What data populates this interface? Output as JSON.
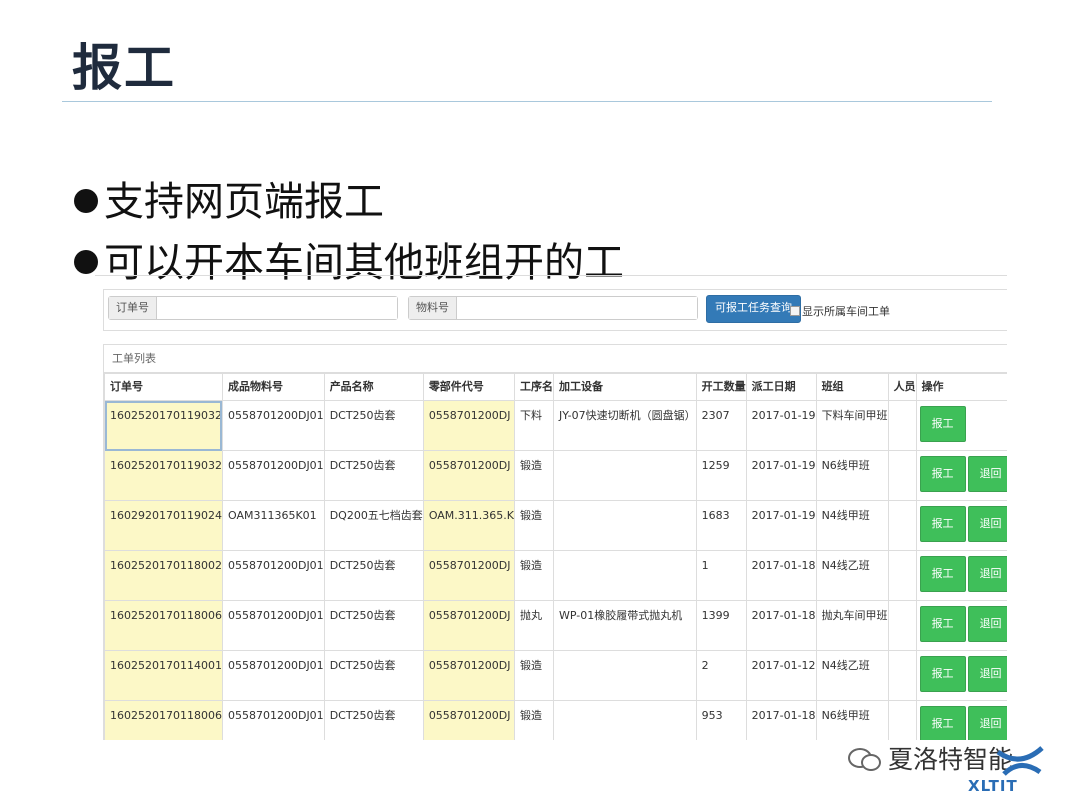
{
  "slide": {
    "title": "报工",
    "bullets": [
      "支持网页端报工",
      "可以开本车间其他班组开的工"
    ]
  },
  "search": {
    "order_label": "订单号",
    "order_value": "",
    "material_label": "物料号",
    "material_value": "",
    "query_button": "可报工任务查询",
    "checkbox_label": "显示所属车间工单",
    "checkbox_checked": false
  },
  "panel": {
    "title": "工单列表",
    "columns": [
      "订单号",
      "成品物料号",
      "产品名称",
      "零部件代号",
      "工序名",
      "加工设备",
      "开工数量",
      "派工日期",
      "班组",
      "人员",
      "操作"
    ],
    "rows": [
      {
        "order": "1602520170119032",
        "product_code": "0558701200DJ01",
        "product_name": "DCT250齿套",
        "part_code": "0558701200DJ",
        "process": "下料",
        "equipment": "JY-07快速切断机（圆盘锯）",
        "qty": "2307",
        "date": "2017-01-19",
        "team": "下料车间甲班",
        "person": "",
        "report": "报工",
        "back": ""
      },
      {
        "order": "1602520170119032",
        "product_code": "0558701200DJ01",
        "product_name": "DCT250齿套",
        "part_code": "0558701200DJ",
        "process": "锻造",
        "equipment": "",
        "qty": "1259",
        "date": "2017-01-19",
        "team": "N6线甲班",
        "person": "",
        "report": "报工",
        "back": "退回"
      },
      {
        "order": "1602920170119024",
        "product_code": "OAM311365K01",
        "product_name": "DQ200五七档齿套",
        "part_code": "OAM.311.365.K",
        "process": "锻造",
        "equipment": "",
        "qty": "1683",
        "date": "2017-01-19",
        "team": "N4线甲班",
        "person": "",
        "report": "报工",
        "back": "退回"
      },
      {
        "order": "1602520170118002",
        "product_code": "0558701200DJ01",
        "product_name": "DCT250齿套",
        "part_code": "0558701200DJ",
        "process": "锻造",
        "equipment": "",
        "qty": "1",
        "date": "2017-01-18",
        "team": "N4线乙班",
        "person": "",
        "report": "报工",
        "back": "退回"
      },
      {
        "order": "1602520170118006",
        "product_code": "0558701200DJ01",
        "product_name": "DCT250齿套",
        "part_code": "0558701200DJ",
        "process": "抛丸",
        "equipment": "WP-01橡胶履带式抛丸机",
        "qty": "1399",
        "date": "2017-01-18",
        "team": "抛丸车间甲班",
        "person": "",
        "report": "报工",
        "back": "退回"
      },
      {
        "order": "1602520170114001",
        "product_code": "0558701200DJ01",
        "product_name": "DCT250齿套",
        "part_code": "0558701200DJ",
        "process": "锻造",
        "equipment": "",
        "qty": "2",
        "date": "2017-01-12",
        "team": "N4线乙班",
        "person": "",
        "report": "报工",
        "back": "退回"
      },
      {
        "order": "1602520170118006",
        "product_code": "0558701200DJ01",
        "product_name": "DCT250齿套",
        "part_code": "0558701200DJ",
        "process": "锻造",
        "equipment": "",
        "qty": "953",
        "date": "2017-01-18",
        "team": "N6线甲班",
        "person": "",
        "report": "报工",
        "back": "退回"
      }
    ]
  },
  "watermark": {
    "text": "夏洛特智能",
    "logo_text": "XLTIT",
    "icon": "wechat-icon"
  },
  "colors": {
    "highlight": "#fcf8c7",
    "primary_button": "#337ab7",
    "action_button": "#3fbf5a",
    "title": "#1f2b3d"
  }
}
